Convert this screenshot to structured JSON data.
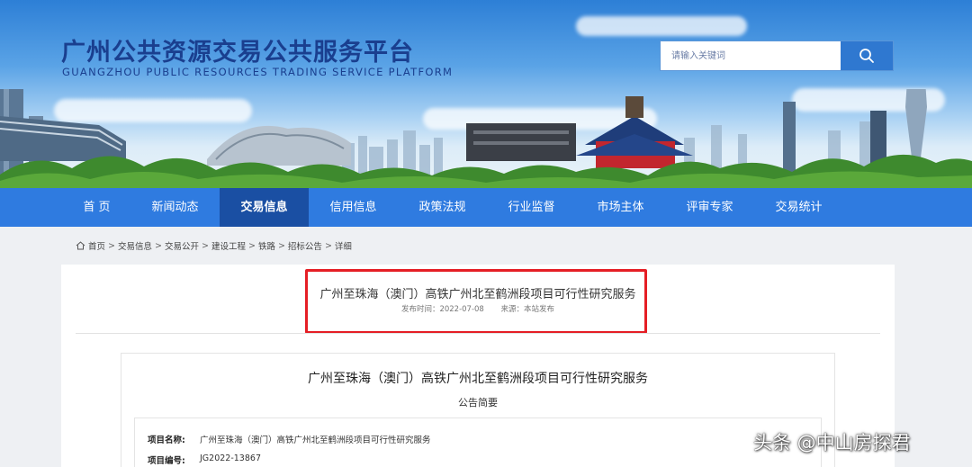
{
  "header": {
    "title": "广州公共资源交易公共服务平台",
    "subtitle": "GUANGZHOU PUBLIC RESOURCES TRADING SERVICE PLATFORM",
    "search_placeholder": "请输入关键词"
  },
  "nav": {
    "items": [
      {
        "label": "首 页",
        "active": false
      },
      {
        "label": "新闻动态",
        "active": false
      },
      {
        "label": "交易信息",
        "active": true
      },
      {
        "label": "信用信息",
        "active": false
      },
      {
        "label": "政策法规",
        "active": false
      },
      {
        "label": "行业监督",
        "active": false
      },
      {
        "label": "市场主体",
        "active": false
      },
      {
        "label": "评审专家",
        "active": false
      },
      {
        "label": "交易统计",
        "active": false
      }
    ]
  },
  "breadcrumb": [
    "首页",
    "交易信息",
    "交易公开",
    "建设工程",
    "铁路",
    "招标公告",
    "详细"
  ],
  "article": {
    "title": "广州至珠海（澳门）高铁广州北至鹤洲段项目可行性研究服务",
    "publish_time": "发布时间：2022-07-08",
    "source": "来源：本站发布"
  },
  "document": {
    "title": "广州至珠海（澳门）高铁广州北至鹤洲段项目可行性研究服务",
    "subtitle": "公告简要",
    "rows": [
      {
        "label": "项目名称:",
        "value": "广州至珠海（澳门）高铁广州北至鹤洲段项目可行性研究服务"
      },
      {
        "label": "项目编号:",
        "value": "JG2022-13867"
      }
    ]
  },
  "watermark": "头条 @中山房探君",
  "colors": {
    "nav_bg": "#2f7be0",
    "nav_active": "#1a4fa3",
    "title_blue": "#1a3f8f",
    "highlight_red": "#e51e25"
  }
}
